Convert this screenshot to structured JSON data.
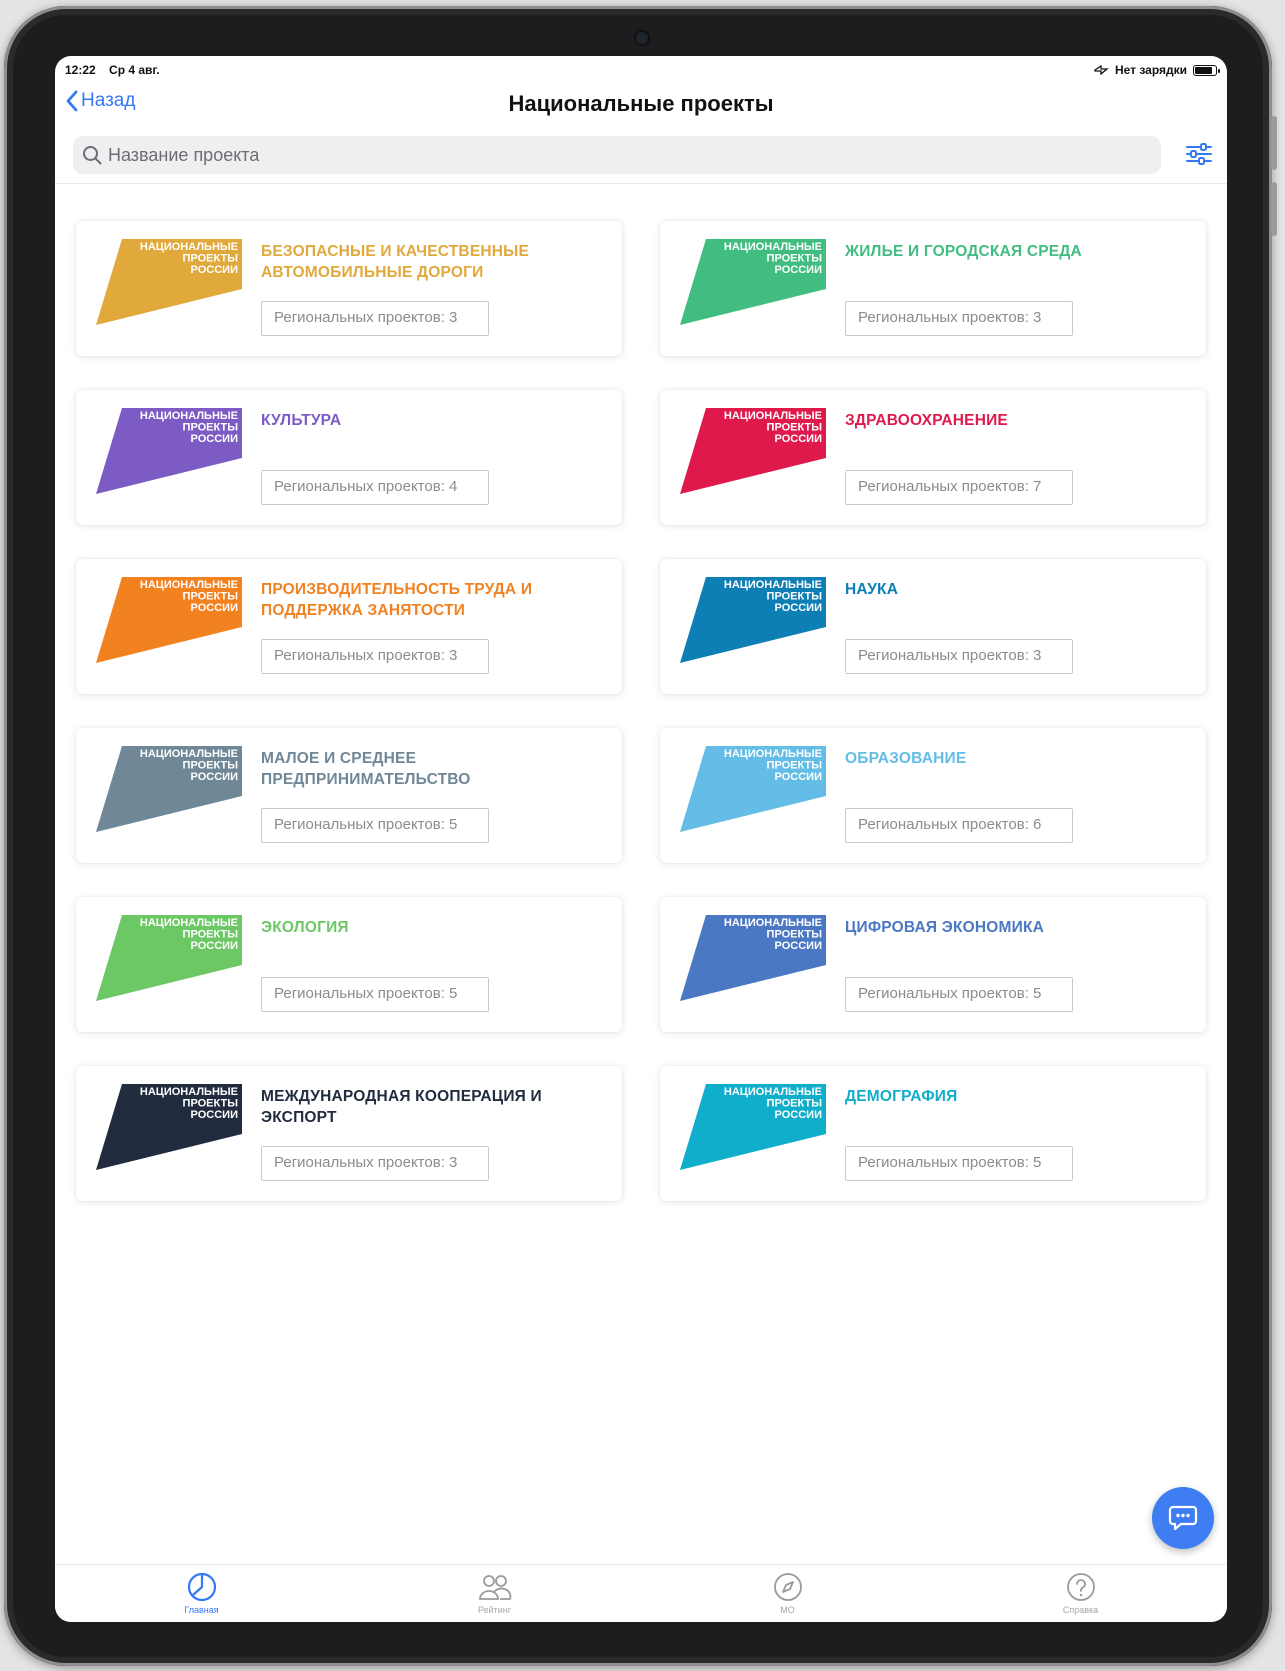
{
  "status_bar": {
    "time": "12:22",
    "date": "Ср 4 авг.",
    "charging": "Нет зарядки"
  },
  "nav": {
    "back_label": "Назад",
    "title": "Национальные проекты"
  },
  "search": {
    "placeholder": "Название проекта"
  },
  "logo_text": [
    "НАЦИОНАЛЬНЫЕ",
    "ПРОЕКТЫ",
    "РОССИИ"
  ],
  "projects": [
    {
      "title": "Безопасные и качественные автомобильные дороги",
      "count": "Региональных проектов: 3",
      "color": "#e1a83b"
    },
    {
      "title": "Жилье и городская среда",
      "count": "Региональных проектов: 3",
      "color": "#41bd81"
    },
    {
      "title": "Культура",
      "count": "Региональных проектов: 4",
      "color": "#7c5cc4"
    },
    {
      "title": "Здравоохранение",
      "count": "Региональных проектов: 7",
      "color": "#e0194d"
    },
    {
      "title": "Производительность труда и поддержка занятости",
      "count": "Региональных проектов: 3",
      "color": "#f28120"
    },
    {
      "title": "Наука",
      "count": "Региональных проектов: 3",
      "color": "#0e7fb5"
    },
    {
      "title": "Малое и среднее предпринимательство",
      "count": "Региональных проектов: 5",
      "color": "#6f8796"
    },
    {
      "title": "Образование",
      "count": "Региональных проектов: 6",
      "color": "#63bde6"
    },
    {
      "title": "Экология",
      "count": "Региональных проектов: 5",
      "color": "#6cc765"
    },
    {
      "title": "Цифровая экономика",
      "count": "Региональных проектов: 5",
      "color": "#4a78c2"
    },
    {
      "title": "Международная кооперация и экспорт",
      "count": "Региональных проектов: 3",
      "color": "#212c3f"
    },
    {
      "title": "Демография",
      "count": "Региональных проектов: 5",
      "color": "#10aecb"
    }
  ],
  "tabs": [
    {
      "label": "Главная",
      "icon": "pie-chart-icon",
      "active": true
    },
    {
      "label": "Рейтинг",
      "icon": "people-icon",
      "active": false
    },
    {
      "label": "МО",
      "icon": "compass-icon",
      "active": false
    },
    {
      "label": "Справка",
      "icon": "help-icon",
      "active": false
    }
  ],
  "colors": {
    "accent": "#3478f6",
    "fab": "#3e7ef2"
  }
}
